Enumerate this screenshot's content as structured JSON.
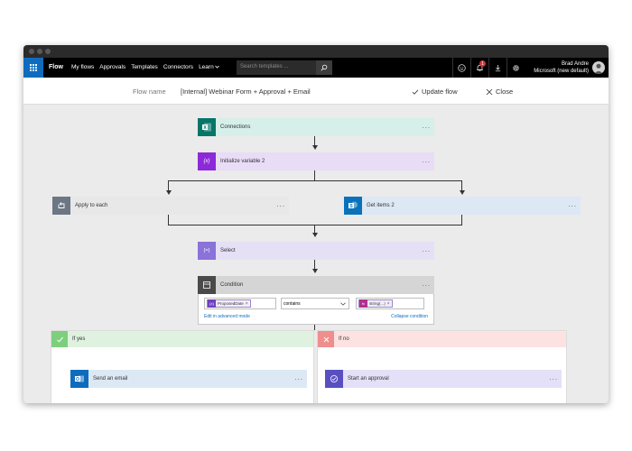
{
  "nav": {
    "brand": "Flow",
    "links": [
      "My flows",
      "Approvals",
      "Templates",
      "Connectors",
      "Learn"
    ],
    "search_placeholder": "Search templates ...",
    "notification_count": "1",
    "user_name": "Brad Andre",
    "user_org": "Microsoft (new default)"
  },
  "header": {
    "flow_name_label": "Flow name",
    "flow_name": "[Internal] Webinar Form + Approval + Email",
    "update_label": "Update flow",
    "close_label": "Close"
  },
  "steps": {
    "connections": "Connections",
    "init_var": "Initialize variable 2",
    "apply_each": "Apply to each",
    "get_items": "Get items 2",
    "select": "Select",
    "condition": "Condition"
  },
  "condition": {
    "left_token": "ProposedDate",
    "left_token_icon": "{x}",
    "operator": "contains",
    "right_token": "string(...)",
    "right_token_icon": "fx",
    "edit_link": "Edit in advanced mode",
    "collapse_link": "Collapse condition"
  },
  "branches": {
    "yes_label": "If yes",
    "no_label": "If no",
    "yes_action": "Send an email",
    "no_action": "Start an approval"
  },
  "icons": {
    "forms": "X",
    "variable": "{x}",
    "select": "{=}"
  },
  "colors": {
    "accent": "#0f6cbd",
    "forms_green": "#077568",
    "variable_purple": "#8c2ad8",
    "data_purple": "#8a72d8",
    "loop_gray": "#6d7685",
    "sharepoint": "#0a72bb",
    "outlook": "#0f6cbd",
    "approval": "#5a4fc0",
    "yes_green": "#7dcf7d",
    "no_red": "#f08d8d"
  }
}
